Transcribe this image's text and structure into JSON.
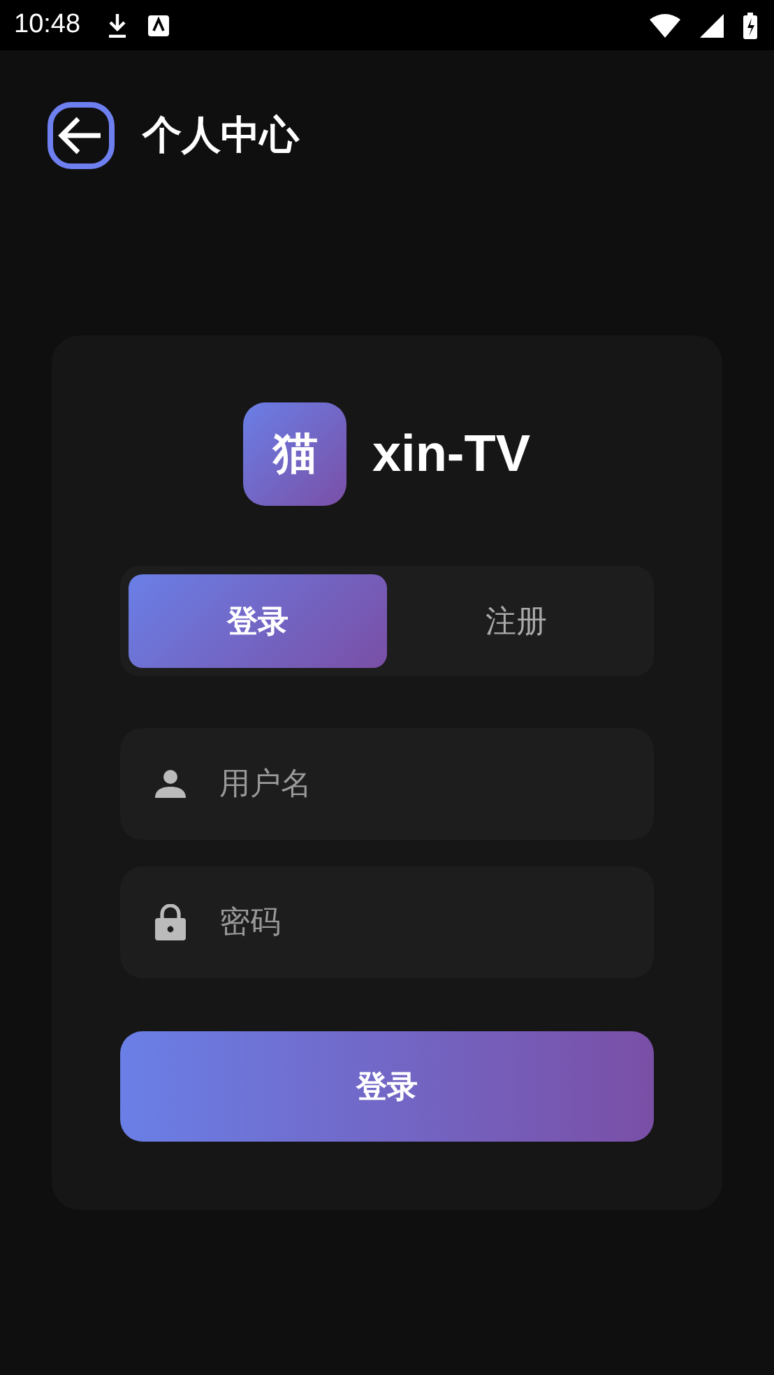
{
  "status_bar": {
    "time": "10:48"
  },
  "header": {
    "title": "个人中心"
  },
  "app": {
    "logo_char": "猫",
    "name": "xin-TV"
  },
  "tabs": [
    {
      "label": "登录",
      "selected": true
    },
    {
      "label": "注册",
      "selected": false
    }
  ],
  "fields": [
    {
      "kind": "user",
      "placeholder": "用户名"
    },
    {
      "kind": "password",
      "placeholder": "密码"
    }
  ],
  "submit": {
    "label": "登录"
  }
}
